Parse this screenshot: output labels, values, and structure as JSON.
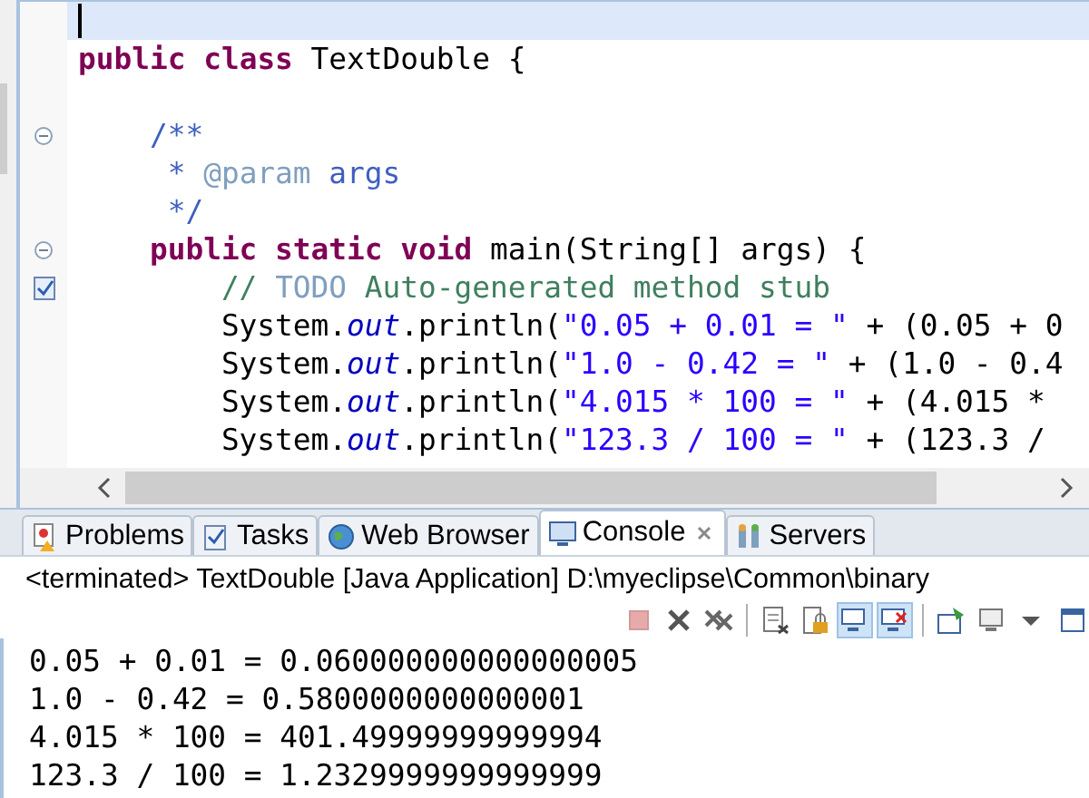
{
  "editor": {
    "lines": [
      {
        "kind": "plain",
        "current": true
      },
      {
        "kind": "plain",
        "current": false,
        "tokens": [
          {
            "kind": "keyword",
            "text": "public"
          },
          {
            "kind": "keyword",
            "text": " class"
          },
          {
            "kind": "plain",
            "text": " TextDouble {"
          }
        ]
      },
      {
        "kind": "plain",
        "current": false
      },
      {
        "kind": "fold",
        "current": false,
        "tokens": [
          {
            "kind": "javadoc",
            "text": "    /**"
          }
        ]
      },
      {
        "kind": "plain",
        "current": false,
        "tokens": [
          {
            "kind": "javadoc",
            "text": "     * "
          },
          {
            "kind": "javadoc_tag",
            "text": "@param"
          },
          {
            "kind": "javadoc",
            "text": " args"
          }
        ]
      },
      {
        "kind": "plain",
        "current": false,
        "tokens": [
          {
            "kind": "javadoc",
            "text": "     */"
          }
        ]
      },
      {
        "kind": "fold",
        "current": false,
        "tokens": [
          {
            "kind": "keyword",
            "text": "    public"
          },
          {
            "kind": "keyword",
            "text": " static"
          },
          {
            "kind": "keyword",
            "text": " void"
          },
          {
            "kind": "plain",
            "text": " main(String[] args) {"
          }
        ]
      },
      {
        "kind": "task",
        "current": false,
        "tokens": [
          {
            "kind": "comment",
            "text": "        // "
          },
          {
            "kind": "todo",
            "text": "TODO"
          },
          {
            "kind": "comment",
            "text": " Auto-generated method stub"
          }
        ]
      },
      {
        "kind": "plain",
        "current": false,
        "tokens": [
          {
            "kind": "plain",
            "text": "        System."
          },
          {
            "kind": "field",
            "text": "out"
          },
          {
            "kind": "plain",
            "text": ".println("
          },
          {
            "kind": "string",
            "text": "\"0.05 + 0.01 = \""
          },
          {
            "kind": "plain",
            "text": " + (0.05 + 0"
          }
        ]
      },
      {
        "kind": "plain",
        "current": false,
        "tokens": [
          {
            "kind": "plain",
            "text": "        System."
          },
          {
            "kind": "field",
            "text": "out"
          },
          {
            "kind": "plain",
            "text": ".println("
          },
          {
            "kind": "string",
            "text": "\"1.0 - 0.42 = \""
          },
          {
            "kind": "plain",
            "text": " + (1.0 - 0.4"
          }
        ]
      },
      {
        "kind": "plain",
        "current": false,
        "tokens": [
          {
            "kind": "plain",
            "text": "        System."
          },
          {
            "kind": "field",
            "text": "out"
          },
          {
            "kind": "plain",
            "text": ".println("
          },
          {
            "kind": "string",
            "text": "\"4.015 * 100 = \""
          },
          {
            "kind": "plain",
            "text": " + (4.015 *"
          }
        ]
      },
      {
        "kind": "plain",
        "current": false,
        "tokens": [
          {
            "kind": "plain",
            "text": "        System."
          },
          {
            "kind": "field",
            "text": "out"
          },
          {
            "kind": "plain",
            "text": ".println("
          },
          {
            "kind": "string",
            "text": "\"123.3 / 100 = \""
          },
          {
            "kind": "plain",
            "text": " + (123.3 /"
          }
        ]
      }
    ]
  },
  "tabs": [
    {
      "label": "Problems",
      "kind": "problems",
      "selected": false
    },
    {
      "label": "Tasks",
      "kind": "tasks",
      "selected": false
    },
    {
      "label": "Web Browser",
      "kind": "globe",
      "selected": false
    },
    {
      "label": "Console",
      "kind": "console",
      "selected": true
    },
    {
      "label": "Servers",
      "kind": "servers",
      "selected": false
    }
  ],
  "console": {
    "header": "<terminated> TextDouble [Java Application] D:\\myeclipse\\Common\\binary",
    "toolbar": [
      {
        "kind": "terminate",
        "disabled": true,
        "selected": false
      },
      {
        "kind": "remove",
        "disabled": false,
        "selected": false
      },
      {
        "kind": "remove_all",
        "disabled": false,
        "selected": false
      },
      {
        "kind": "separator"
      },
      {
        "kind": "clear",
        "disabled": false,
        "selected": false
      },
      {
        "kind": "lock",
        "disabled": false,
        "selected": false
      },
      {
        "kind": "stdout",
        "disabled": false,
        "selected": true
      },
      {
        "kind": "stderr",
        "disabled": false,
        "selected": true
      },
      {
        "kind": "separator"
      },
      {
        "kind": "pin",
        "disabled": false,
        "selected": false
      },
      {
        "kind": "display",
        "disabled": false,
        "selected": false
      },
      {
        "kind": "caret",
        "disabled": false,
        "selected": false
      },
      {
        "kind": "window",
        "disabled": false,
        "selected": false
      }
    ],
    "output": [
      "0.05 + 0.01 = 0.060000000000000005",
      "1.0 - 0.42 = 0.5800000000000001",
      "4.015 * 100 = 401.49999999999994",
      "123.3 / 100 = 1.2329999999999999"
    ]
  }
}
